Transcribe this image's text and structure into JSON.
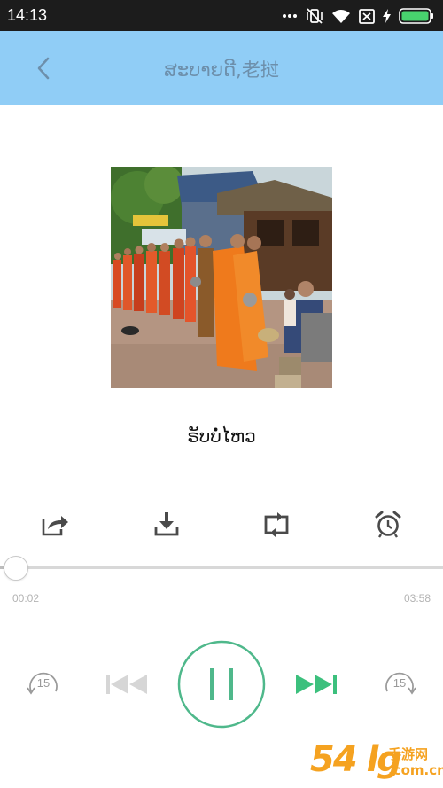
{
  "status_bar": {
    "time": "14:13",
    "icons": [
      "dots-icon",
      "vibrate-off-icon",
      "wifi-icon",
      "sim-off-icon",
      "charging-icon",
      "battery-icon"
    ]
  },
  "header": {
    "back_icon": "chevron-left-icon",
    "title": "ສະບາຍດີ,老挝"
  },
  "track": {
    "title": "ຣັບບໍ່ໄຫວ"
  },
  "actions": [
    {
      "icon": "share-icon"
    },
    {
      "icon": "download-icon"
    },
    {
      "icon": "repeat-icon"
    },
    {
      "icon": "alarm-clock-icon"
    }
  ],
  "playback": {
    "elapsed": "00:02",
    "total": "03:58",
    "progress": 0.008
  },
  "controls": {
    "rewind_seconds": "15",
    "forward_seconds": "15",
    "state": "playing"
  },
  "colors": {
    "header_bg": "#90cdf6",
    "accent_green": "#4fb88b",
    "next_green": "#3cc07d",
    "status_bar_bg": "#1c1c1c"
  },
  "watermark": {
    "left": "54 lg",
    "line1": "手游网",
    "line2": ".com.cn"
  }
}
